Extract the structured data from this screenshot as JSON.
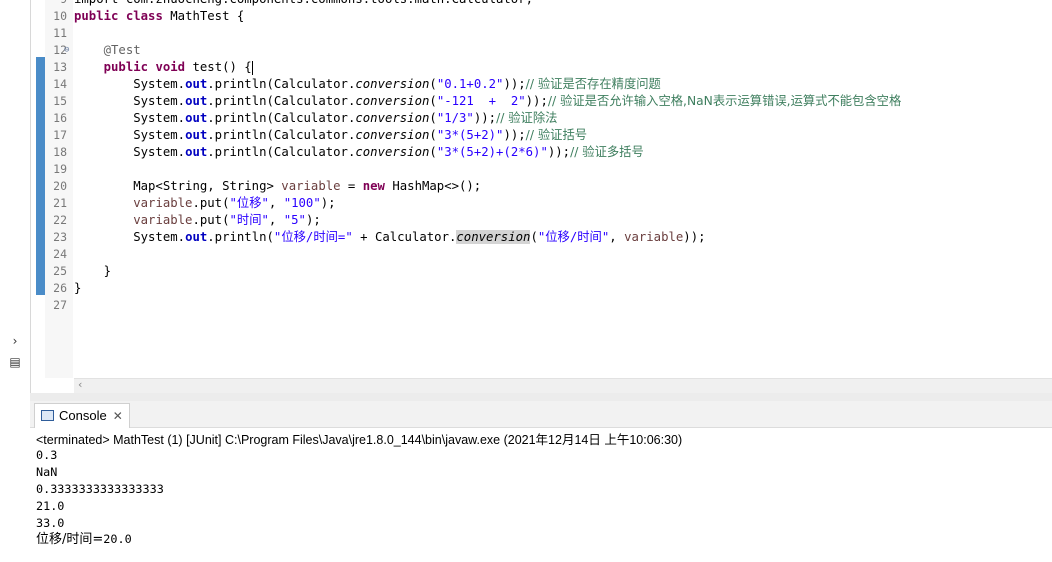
{
  "editor": {
    "lines": [
      {
        "n": "9",
        "segs": [
          {
            "c": "plain",
            "t": "import com.zhuocheng.components.commons.tools.math.Calculator;"
          }
        ]
      },
      {
        "n": "10",
        "segs": [
          {
            "c": "kw",
            "t": "public"
          },
          {
            "c": "plain",
            "t": " "
          },
          {
            "c": "kw",
            "t": "class"
          },
          {
            "c": "plain",
            "t": " MathTest {"
          }
        ]
      },
      {
        "n": "11",
        "segs": []
      },
      {
        "n": "12",
        "fold": "⊖",
        "segs": [
          {
            "c": "plain",
            "t": "    "
          },
          {
            "c": "ann",
            "t": "@Test"
          }
        ]
      },
      {
        "n": "13",
        "cursor": true,
        "segs": [
          {
            "c": "plain",
            "t": "    "
          },
          {
            "c": "kw",
            "t": "public"
          },
          {
            "c": "plain",
            "t": " "
          },
          {
            "c": "kw",
            "t": "void"
          },
          {
            "c": "plain",
            "t": " test() {"
          }
        ]
      },
      {
        "n": "14",
        "segs": [
          {
            "c": "plain",
            "t": "        System."
          },
          {
            "c": "fld",
            "t": "out"
          },
          {
            "c": "plain",
            "t": ".println(Calculator."
          },
          {
            "c": "sm",
            "t": "conversion"
          },
          {
            "c": "plain",
            "t": "("
          },
          {
            "c": "str",
            "t": "\"0.1+0.2\""
          },
          {
            "c": "plain",
            "t": "));"
          },
          {
            "c": "cmt",
            "t": "// 验证是否存在精度问题"
          }
        ]
      },
      {
        "n": "15",
        "segs": [
          {
            "c": "plain",
            "t": "        System."
          },
          {
            "c": "fld",
            "t": "out"
          },
          {
            "c": "plain",
            "t": ".println(Calculator."
          },
          {
            "c": "sm",
            "t": "conversion"
          },
          {
            "c": "plain",
            "t": "("
          },
          {
            "c": "str",
            "t": "\"-121  +  2\""
          },
          {
            "c": "plain",
            "t": "));"
          },
          {
            "c": "cmt",
            "t": "// 验证是否允许输入空格,NaN表示运算错误,运算式不能包含空格"
          }
        ]
      },
      {
        "n": "16",
        "segs": [
          {
            "c": "plain",
            "t": "        System."
          },
          {
            "c": "fld",
            "t": "out"
          },
          {
            "c": "plain",
            "t": ".println(Calculator."
          },
          {
            "c": "sm",
            "t": "conversion"
          },
          {
            "c": "plain",
            "t": "("
          },
          {
            "c": "str",
            "t": "\"1/3\""
          },
          {
            "c": "plain",
            "t": "));"
          },
          {
            "c": "cmt",
            "t": "// 验证除法"
          }
        ]
      },
      {
        "n": "17",
        "segs": [
          {
            "c": "plain",
            "t": "        System."
          },
          {
            "c": "fld",
            "t": "out"
          },
          {
            "c": "plain",
            "t": ".println(Calculator."
          },
          {
            "c": "sm",
            "t": "conversion"
          },
          {
            "c": "plain",
            "t": "("
          },
          {
            "c": "str",
            "t": "\"3*(5+2)\""
          },
          {
            "c": "plain",
            "t": "));"
          },
          {
            "c": "cmt",
            "t": "// 验证括号"
          }
        ]
      },
      {
        "n": "18",
        "segs": [
          {
            "c": "plain",
            "t": "        System."
          },
          {
            "c": "fld",
            "t": "out"
          },
          {
            "c": "plain",
            "t": ".println(Calculator."
          },
          {
            "c": "sm",
            "t": "conversion"
          },
          {
            "c": "plain",
            "t": "("
          },
          {
            "c": "str",
            "t": "\"3*(5+2)+(2*6)\""
          },
          {
            "c": "plain",
            "t": "));"
          },
          {
            "c": "cmt",
            "t": "// 验证多括号"
          }
        ]
      },
      {
        "n": "19",
        "segs": []
      },
      {
        "n": "20",
        "segs": [
          {
            "c": "plain",
            "t": "        Map<String, String> "
          },
          {
            "c": "lvar",
            "t": "variable"
          },
          {
            "c": "plain",
            "t": " = "
          },
          {
            "c": "kw",
            "t": "new"
          },
          {
            "c": "plain",
            "t": " HashMap<>();"
          }
        ]
      },
      {
        "n": "21",
        "segs": [
          {
            "c": "plain",
            "t": "        "
          },
          {
            "c": "lvar",
            "t": "variable"
          },
          {
            "c": "plain",
            "t": ".put("
          },
          {
            "c": "str",
            "t": "\"位移\""
          },
          {
            "c": "plain",
            "t": ", "
          },
          {
            "c": "str",
            "t": "\"100\""
          },
          {
            "c": "plain",
            "t": ");"
          }
        ]
      },
      {
        "n": "22",
        "segs": [
          {
            "c": "plain",
            "t": "        "
          },
          {
            "c": "lvar",
            "t": "variable"
          },
          {
            "c": "plain",
            "t": ".put("
          },
          {
            "c": "str",
            "t": "\"时间\""
          },
          {
            "c": "plain",
            "t": ", "
          },
          {
            "c": "str",
            "t": "\"5\""
          },
          {
            "c": "plain",
            "t": ");"
          }
        ]
      },
      {
        "n": "23",
        "segs": [
          {
            "c": "plain",
            "t": "        System."
          },
          {
            "c": "fld",
            "t": "out"
          },
          {
            "c": "plain",
            "t": ".println("
          },
          {
            "c": "str",
            "t": "\"位移/时间=\""
          },
          {
            "c": "plain",
            "t": " + Calculator."
          },
          {
            "c": "sm occ",
            "t": "conversion"
          },
          {
            "c": "plain",
            "t": "("
          },
          {
            "c": "str",
            "t": "\"位移/时间\""
          },
          {
            "c": "plain",
            "t": ", "
          },
          {
            "c": "lvar",
            "t": "variable"
          },
          {
            "c": "plain",
            "t": "));"
          }
        ]
      },
      {
        "n": "24",
        "segs": []
      },
      {
        "n": "25",
        "segs": [
          {
            "c": "plain",
            "t": "    }"
          }
        ]
      },
      {
        "n": "26",
        "segs": [
          {
            "c": "plain",
            "t": "}"
          }
        ]
      },
      {
        "n": "27",
        "segs": []
      }
    ]
  },
  "console": {
    "tab_label": "Console",
    "tab_close": "✕",
    "status": "<terminated> MathTest (1) [JUnit] C:\\Program Files\\Java\\jre1.8.0_144\\bin\\javaw.exe (2021年12月14日 上午10:06:30)",
    "output": [
      "0.3",
      "NaN",
      "0.3333333333333333",
      "21.0",
      "33.0"
    ],
    "last_prefix": "位移/时间=",
    "last_value": "20.0"
  },
  "colors": {
    "keyword": "#7f0055",
    "string": "#2a00ff",
    "comment": "#3f7f5f",
    "field": "#0000c0",
    "local_var": "#6a3e3e",
    "annotation": "#646464"
  },
  "icons": [
    "fold-minus-icon",
    "chevron-right-icon",
    "restore-view-icon",
    "console-icon",
    "close-icon",
    "scroll-left-icon"
  ]
}
